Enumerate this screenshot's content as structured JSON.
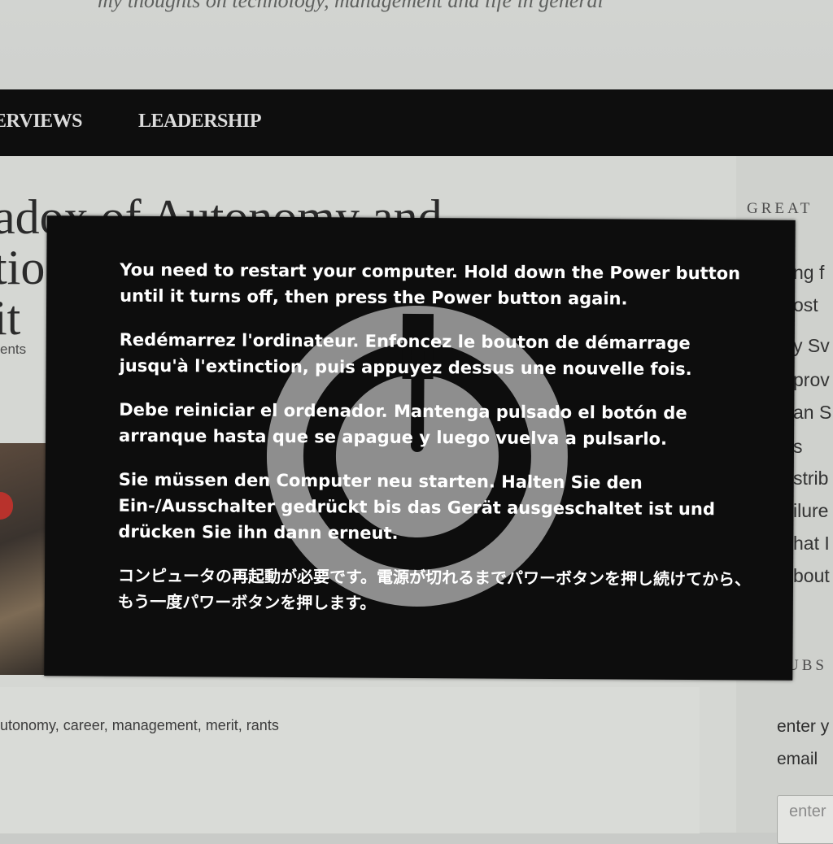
{
  "blog": {
    "tagline": "my thoughts on technology, management and life in general",
    "nav": {
      "interviews": "ERVIEWS",
      "leadership": "LEADERSHIP"
    },
    "post": {
      "title_line1": "adox of Autonomy and",
      "title_line2": "tio",
      "title_line3": "it",
      "meta": "ents",
      "tags": "utonomy, career, management, merit, rants"
    },
    "sidebar": {
      "heading": "GREAT",
      "lines": [
        "ng f",
        "ost",
        "y Sv",
        "prov",
        "an S",
        "s",
        "strib",
        "ilure",
        "hat I",
        "bout"
      ],
      "subscribe_heading": "UBS",
      "subscribe_line1": "enter y",
      "subscribe_line2": "email",
      "subscribe_placeholder": "enter"
    }
  },
  "panic": {
    "messages": {
      "en": "You need to restart your computer. Hold down the Power button until it turns off, then press the Power button again.",
      "fr": "Redémarrez l'ordinateur. Enfoncez le bouton de démarrage jusqu'à l'extinction, puis appuyez dessus une nouvelle fois.",
      "es": "Debe reiniciar el ordenador. Mantenga pulsado el botón de arranque hasta que se apague y luego vuelva a pulsarlo.",
      "de": "Sie müssen den Computer neu starten. Halten Sie den Ein-/Ausschalter gedrückt bis das Gerät ausgeschaltet ist und drücken Sie ihn dann erneut.",
      "ja": "コンピュータの再起動が必要です。電源が切れるまでパワーボタンを押し続けてから、もう一度パワーボタンを押します。"
    },
    "icon": "power-icon"
  },
  "colors": {
    "overlay": "#0d0d0d",
    "overlay_text": "#ffffff",
    "navbar": "#0e0e0e",
    "icon_gray": "#8e8e8e"
  }
}
